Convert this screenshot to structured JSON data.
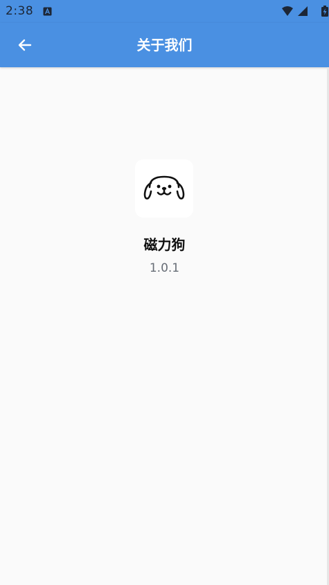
{
  "status_bar": {
    "time": "2:38",
    "app_icon": "a-badge-icon",
    "wifi": "wifi-icon",
    "signal": "signal-icon",
    "battery": "battery-charging-icon"
  },
  "app_bar": {
    "title": "关于我们",
    "back_icon": "arrow-left-icon"
  },
  "about": {
    "app_name": "磁力狗",
    "version": "1.0.1",
    "logo_icon": "dog-face-icon"
  },
  "colors": {
    "primary": "#4a90e2",
    "background": "#fafafa",
    "title_text": "#ffffff",
    "name_text": "#111111",
    "version_text": "#666c75"
  }
}
